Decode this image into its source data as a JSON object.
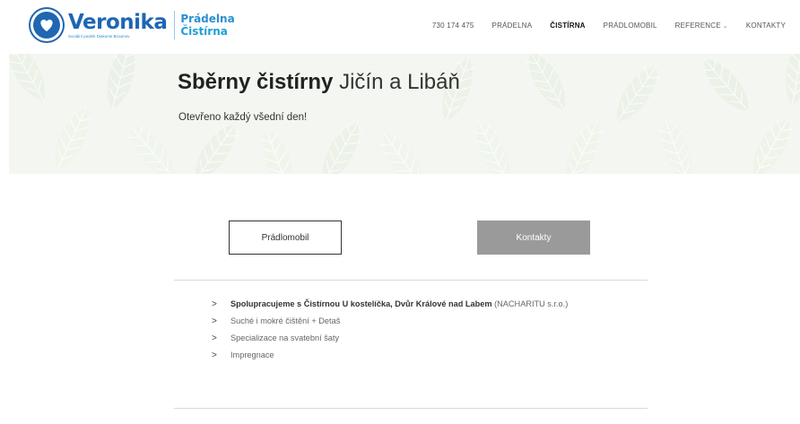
{
  "header": {
    "brand_name": "Veronika",
    "brand_tagline": "Sociální podnik Diakonie Broumov",
    "brand_side_1": "Prádelna",
    "brand_side_2": "Čistírna",
    "nav": [
      {
        "label": "730 174 475"
      },
      {
        "label": "PRÁDELNA"
      },
      {
        "label": "ČISTÍRNA",
        "active": true
      },
      {
        "label": "PRÁDLOMOBIL"
      },
      {
        "label": "REFERENCE"
      },
      {
        "label": "KONTAKTY"
      }
    ],
    "reference_chevron": "⌄"
  },
  "hero": {
    "title_bold": "Sběrny čistírny",
    "title_light": "Jičín a Libáň",
    "subtitle": "Otevřeno každý všední den!"
  },
  "buttons": {
    "pradlomobil": "Prádlomobil",
    "kontakty": "Kontakty"
  },
  "list": {
    "items": [
      {
        "bold": "Spolupracujeme s Čistírnou U kostelíčka, Dvůr Králové nad Labem",
        "rest": " (NACHARITU s.r.o.)"
      },
      {
        "bold": "",
        "rest": "Suché i mokré čištění + Detaš"
      },
      {
        "bold": "",
        "rest": "Specializace na svatební šaty"
      },
      {
        "bold": "",
        "rest": "Impregnace"
      }
    ],
    "arrow_glyph": ">"
  },
  "colors": {
    "brand_blue": "#1f66b3",
    "accent_blue": "#2b8fd0",
    "button_gray": "#9a9a9a",
    "hero_bg": "#f2f6ef"
  },
  "icons": {
    "logo": "heart-in-circle-icon",
    "dropdown": "chevron-down-icon",
    "bullet": "chevron-right-icon"
  }
}
